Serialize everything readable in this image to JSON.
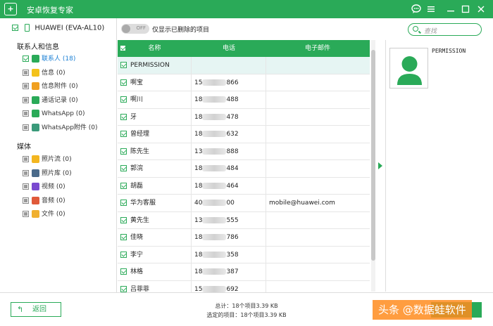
{
  "app": {
    "logo": "+",
    "title": "安卓恢复专家"
  },
  "window_controls": [
    "chat-icon",
    "menu-icon",
    "minimize-icon",
    "maximize-icon",
    "close-icon"
  ],
  "device": {
    "name": "HUAWEI (EVA-AL10)"
  },
  "sidebar": {
    "sections": [
      {
        "title": "联系人和信息",
        "items": [
          {
            "label": "联系人 (18)",
            "icon": "contacts-icon",
            "color": "#2aaa58",
            "checked": true,
            "selected": true
          },
          {
            "label": "信息 (0)",
            "icon": "message-icon",
            "color": "#f3c21b"
          },
          {
            "label": "信息附件 (0)",
            "icon": "attachment-icon",
            "color": "#f0a020"
          },
          {
            "label": "通话记录 (0)",
            "icon": "call-log-icon",
            "color": "#2aaa58"
          },
          {
            "label": "WhatsApp (0)",
            "icon": "whatsapp-icon",
            "color": "#2aaa58"
          },
          {
            "label": "WhatsApp附件 (0)",
            "icon": "whatsapp-attachment-icon",
            "color": "#3a9a7a"
          }
        ]
      },
      {
        "title": "媒体",
        "items": [
          {
            "label": "照片流 (0)",
            "icon": "photo-stream-icon",
            "color": "#f3b620"
          },
          {
            "label": "照片库 (0)",
            "icon": "photo-library-icon",
            "color": "#4a6a8a"
          },
          {
            "label": "视频 (0)",
            "icon": "video-icon",
            "color": "#7a4ad0"
          },
          {
            "label": "音频 (0)",
            "icon": "audio-icon",
            "color": "#e05a3a"
          },
          {
            "label": "文件 (0)",
            "icon": "file-icon",
            "color": "#f0b030"
          }
        ]
      }
    ]
  },
  "toolbar": {
    "toggle_state": "OFF",
    "toggle_label": "仅显示已删除的项目"
  },
  "search": {
    "placeholder": "查找"
  },
  "table": {
    "columns": [
      "名称",
      "电话",
      "电子邮件"
    ],
    "rows": [
      {
        "name": "PERMISSION",
        "phone": "",
        "email": "",
        "group": true
      },
      {
        "name": "啊宝",
        "phone_pre": "15",
        "phone_post": "866",
        "email": ""
      },
      {
        "name": "啊川",
        "phone_pre": "18",
        "phone_post": "488",
        "email": ""
      },
      {
        "name": "牙",
        "phone_pre": "18",
        "phone_post": "478",
        "email": ""
      },
      {
        "name": "曾经理",
        "phone_pre": "18",
        "phone_post": "632",
        "email": ""
      },
      {
        "name": "陈先生",
        "phone_pre": "13",
        "phone_post": "888",
        "email": ""
      },
      {
        "name": "郭浣",
        "phone_pre": "18",
        "phone_post": "484",
        "email": ""
      },
      {
        "name": "胡磊",
        "phone_pre": "18",
        "phone_post": "464",
        "email": ""
      },
      {
        "name": "华为客服",
        "phone_pre": "40",
        "phone_post": "00",
        "email": "mobile@huawei.com"
      },
      {
        "name": "黄先生",
        "phone_pre": "13",
        "phone_post": "555",
        "email": ""
      },
      {
        "name": "佳晓",
        "phone_pre": "18",
        "phone_post": "786",
        "email": ""
      },
      {
        "name": "李宁",
        "phone_pre": "18",
        "phone_post": "358",
        "email": ""
      },
      {
        "name": "林格",
        "phone_pre": "18",
        "phone_post": "387",
        "email": ""
      },
      {
        "name": "吕菲菲",
        "phone_pre": "15",
        "phone_post": "692",
        "email": ""
      }
    ]
  },
  "detail": {
    "name": "PERMISSION"
  },
  "footer": {
    "back_label": "返回",
    "total": "总计：18个项目3.39 KB",
    "selected": "选定的项目：18个项目3.39 KB",
    "watermark": "头条 @数据蛙软件"
  }
}
